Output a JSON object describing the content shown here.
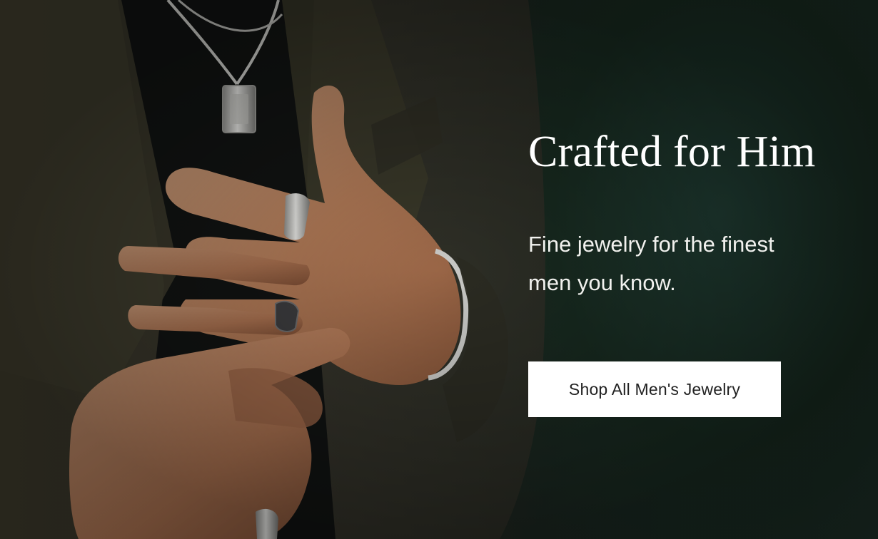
{
  "hero": {
    "headline": "Crafted for Him",
    "subhead": "Fine jewelry for the finest men you know.",
    "cta_label": "Shop All Men's Jewelry",
    "image_description_icon": "hero-photo",
    "colors": {
      "background_green": "#1c2e27",
      "jacket_olive": "#3a3829",
      "skin": "#b98463",
      "silver": "#c9c9c6",
      "button_bg": "#ffffff",
      "button_text": "#222222",
      "text": "#ffffff"
    }
  }
}
